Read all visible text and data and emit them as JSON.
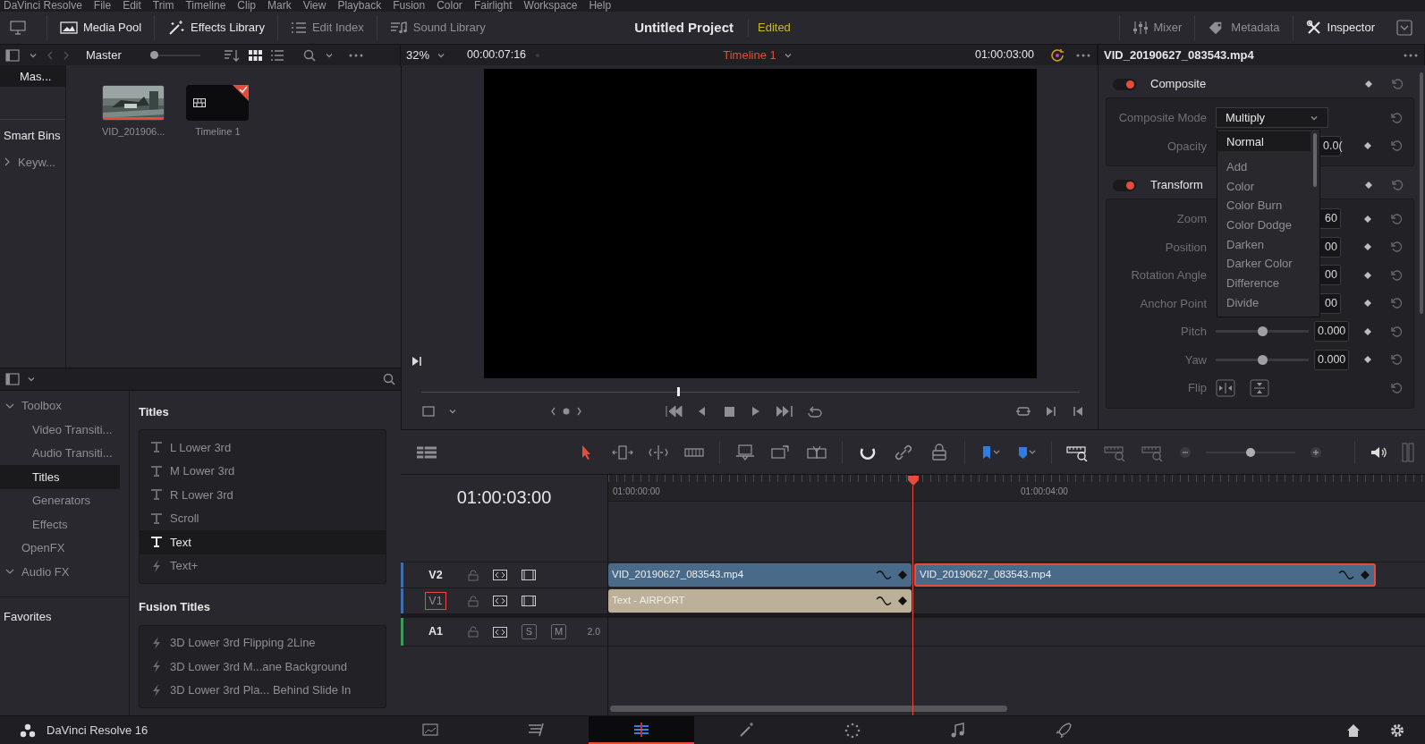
{
  "menu_bar": {
    "items": [
      "DaVinci Resolve",
      "File",
      "Edit",
      "Trim",
      "Timeline",
      "Clip",
      "Mark",
      "View",
      "Playback",
      "Fusion",
      "Color",
      "Fairlight",
      "Workspace",
      "Help"
    ]
  },
  "toolbar": {
    "left_buttons": [
      {
        "label": "Media Pool",
        "active": true
      },
      {
        "label": "Effects Library",
        "active": true
      },
      {
        "label": "Edit Index",
        "active": false
      },
      {
        "label": "Sound Library",
        "active": false
      }
    ],
    "project_title": "Untitled Project",
    "project_status": "Edited",
    "right_buttons": [
      {
        "label": "Mixer",
        "active": false
      },
      {
        "label": "Metadata",
        "active": false
      },
      {
        "label": "Inspector",
        "active": true
      }
    ]
  },
  "media_pool": {
    "bin_label": "Master",
    "zoom_slider": {
      "level": 0
    },
    "view_modes": [
      {
        "selected": true
      },
      {
        "selected": false
      }
    ],
    "bins": [
      {
        "label": "Mas...",
        "selected": true
      }
    ],
    "smart_bins_title": "Smart Bins",
    "smart_bins": [
      {
        "label": "Keyw...",
        "expanded": false
      }
    ],
    "clips": [
      {
        "kind": "video",
        "name": "VID_201906...",
        "in_use": true
      },
      {
        "kind": "timeline",
        "name": "Timeline 1",
        "in_use": true
      }
    ]
  },
  "viewer": {
    "zoom": "32%",
    "duration": "00:00:07:16",
    "timeline_name": "Timeline 1",
    "timecode": "01:00:03:00",
    "scrubber": {
      "level": 0.39
    }
  },
  "inspector": {
    "clip_name": "VID_20190627_083543.mp4",
    "sections": [
      {
        "title": "Composite",
        "enabled": true,
        "params": [
          {
            "kind": "dropdown",
            "label": "Composite Mode",
            "value": "Multiply"
          },
          {
            "kind": "number",
            "label": "Opacity",
            "value": "0.0("
          }
        ]
      },
      {
        "title": "Transform",
        "enabled": true,
        "params": [
          {
            "kind": "number",
            "label": "Zoom",
            "value": "60"
          },
          {
            "kind": "number",
            "label": "Position",
            "value": "00"
          },
          {
            "kind": "number",
            "label": "Rotation Angle",
            "value": "00"
          },
          {
            "kind": "number",
            "label": "Anchor Point",
            "value": "00"
          },
          {
            "kind": "slider",
            "label": "Pitch",
            "level": 0.5,
            "value": "0.000"
          },
          {
            "kind": "slider",
            "label": "Yaw",
            "level": 0.5,
            "value": "0.000"
          },
          {
            "kind": "flip",
            "label": "Flip"
          }
        ]
      }
    ],
    "dropdown_menu": {
      "items": [
        {
          "label": "Normal",
          "selected": true
        },
        {
          "label": "Add",
          "selected": false
        },
        {
          "label": "Color",
          "selected": false
        },
        {
          "label": "Color Burn",
          "selected": false
        },
        {
          "label": "Color Dodge",
          "selected": false
        },
        {
          "label": "Darken",
          "selected": false
        },
        {
          "label": "Darker Color",
          "selected": false
        },
        {
          "label": "Difference",
          "selected": false
        },
        {
          "label": "Divide",
          "selected": false
        }
      ]
    }
  },
  "effects_library": {
    "tree": [
      {
        "label": "Toolbox",
        "expanded": true,
        "selected": false,
        "children": [
          {
            "label": "Video Transiti...",
            "selected": false
          },
          {
            "label": "Audio Transiti...",
            "selected": false
          },
          {
            "label": "Titles",
            "selected": true
          },
          {
            "label": "Generators",
            "selected": false
          },
          {
            "label": "Effects",
            "selected": false
          }
        ]
      },
      {
        "label": "OpenFX",
        "selected": false
      },
      {
        "label": "Audio FX",
        "expanded": true,
        "selected": false
      }
    ],
    "favorites_title": "Favorites",
    "groups": [
      {
        "title": "Titles",
        "items": [
          {
            "kind": "text",
            "label": "L Lower 3rd",
            "selected": false
          },
          {
            "kind": "text",
            "label": "M Lower 3rd",
            "selected": false
          },
          {
            "kind": "text",
            "label": "R Lower 3rd",
            "selected": false
          },
          {
            "kind": "text",
            "label": "Scroll",
            "selected": false
          },
          {
            "kind": "text",
            "label": "Text",
            "selected": true
          },
          {
            "kind": "fusion",
            "label": "Text+",
            "selected": false
          }
        ]
      },
      {
        "title": "Fusion Titles",
        "items": [
          {
            "kind": "fusion",
            "label": "3D Lower 3rd Flipping 2Line",
            "selected": false
          },
          {
            "kind": "fusion",
            "label": "3D Lower 3rd M...ane Background",
            "selected": false
          },
          {
            "kind": "fusion",
            "label": "3D Lower 3rd Pla... Behind Slide In",
            "selected": false
          }
        ]
      }
    ]
  },
  "timeline": {
    "edit_tools": [
      {
        "selected": true
      },
      {
        "selected": false
      },
      {
        "selected": false
      },
      {
        "selected": false
      }
    ],
    "snapping": true,
    "linked_selection": false,
    "zoom_slider": {
      "level": 0.5
    },
    "timecode": "01:00:03:00",
    "ruler_labels": [
      "01:00:00:00",
      "01:00:04:00"
    ],
    "tracks": [
      {
        "name": "V2",
        "kind": "video",
        "selected": false,
        "clips": [
          {
            "kind": "video",
            "label": "VID_20190627_083543.mp4",
            "selected": false
          },
          {
            "kind": "video",
            "label": "VID_20190627_083543.mp4",
            "selected": true
          }
        ]
      },
      {
        "name": "V1",
        "kind": "video",
        "selected": true,
        "clips": [
          {
            "kind": "title",
            "label": "Text - AIRPORT",
            "selected": false
          }
        ]
      },
      {
        "name": "A1",
        "kind": "audio",
        "selected": false,
        "solo": "S",
        "mute": "M",
        "channels": "2.0"
      }
    ]
  },
  "status_bar": {
    "app_name": "DaVinci Resolve 16",
    "pages": [
      {
        "selected": false
      },
      {
        "selected": false
      },
      {
        "selected": true
      },
      {
        "selected": false
      },
      {
        "selected": false
      },
      {
        "selected": false
      },
      {
        "selected": false
      }
    ]
  }
}
